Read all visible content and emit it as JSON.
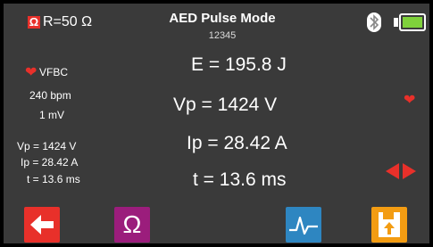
{
  "header": {
    "ohm_badge": "Ω",
    "resistance": "R=50 Ω",
    "title": "AED Pulse Mode",
    "subtitle": "12345"
  },
  "left_panel": {
    "rhythm": "VFBC",
    "rate": "240 bpm",
    "amplitude": "1 mV",
    "vp": "Vp = 1424 V",
    "ip": "Ip = 28.42 A",
    "t": "t = 13.6 ms"
  },
  "readings": {
    "energy": "E = 195.8 J",
    "vp": "Vp = 1424 V",
    "ip": "Ip = 28.42 A",
    "t": "t = 13.6 ms"
  },
  "toolbar": {
    "ohm_label": "Ω"
  },
  "colors": {
    "back": "#e8302a",
    "ohm": "#9b1d7c",
    "waveform": "#2e86c1",
    "save": "#f39c12",
    "battery": "#7fd13b",
    "heart": "#e8302a"
  }
}
